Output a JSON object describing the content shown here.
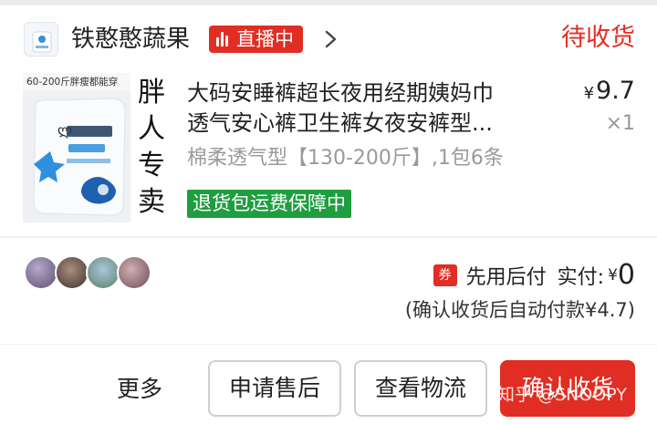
{
  "shop": {
    "name": "铁憨憨蔬果",
    "live_badge": "直播中",
    "status": "待收货"
  },
  "product": {
    "thumb_caption": "60-200斤胖瘦都能穿",
    "thumb_side_text": [
      "胖",
      "人",
      "专",
      "卖"
    ],
    "title_line1": "大码安睡裤超长夜用经期姨妈巾",
    "title_line2": "透气安心裤卫生裤女夜安裤型...",
    "price_symbol": "¥",
    "price": "9.7",
    "quantity": "×1",
    "spec": "棉柔透气型【130-200斤】,1包6条",
    "guarantee": "退货包运费保障中"
  },
  "payment": {
    "coupon_icon_text": "券",
    "mode": "先用后付",
    "paid_label": "实付:",
    "paid_symbol": "¥",
    "paid_amount": "0",
    "auto_pay_note": "(确认收货后自动付款¥4.7)"
  },
  "actions": {
    "more": "更多",
    "after_sale": "申请售后",
    "logistics": "查看物流",
    "confirm": "确认收货"
  },
  "watermark": "知乎 @SNOOPY",
  "colors": {
    "accent_red": "#e02e24",
    "guarantee_green": "#1f9e3f",
    "muted_text": "#9a9a9a"
  }
}
